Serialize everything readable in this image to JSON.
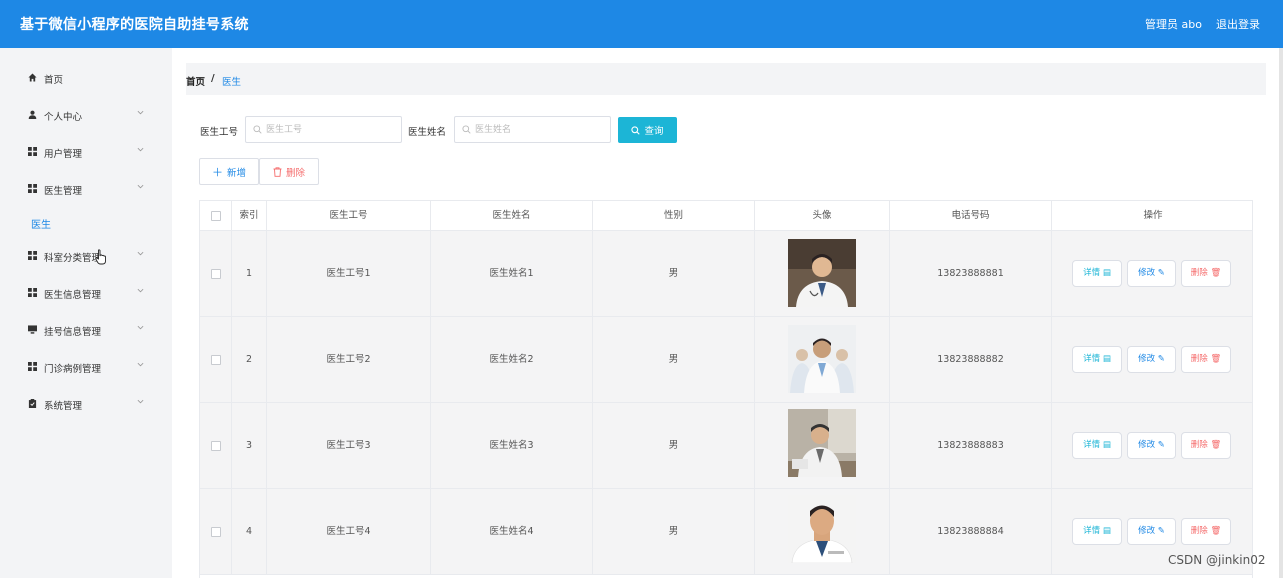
{
  "header": {
    "title": "基于微信小程序的医院自助挂号系统",
    "user": "管理员 abo",
    "logout": "退出登录",
    "color": "#1e88e5"
  },
  "sidebar": {
    "items": [
      {
        "label": "首页",
        "icon": "home-icon",
        "has_chevron": false
      },
      {
        "label": "个人中心",
        "icon": "user-icon",
        "has_chevron": true
      },
      {
        "label": "用户管理",
        "icon": "grid-icon",
        "has_chevron": true
      },
      {
        "label": "医生管理",
        "icon": "grid-icon",
        "has_chevron": true
      },
      {
        "label": "科室分类管理",
        "icon": "grid-icon",
        "has_chevron": true
      },
      {
        "label": "医生信息管理",
        "icon": "grid-icon",
        "has_chevron": true
      },
      {
        "label": "挂号信息管理",
        "icon": "monitor-icon",
        "has_chevron": true
      },
      {
        "label": "门诊病例管理",
        "icon": "grid-icon",
        "has_chevron": true
      },
      {
        "label": "系统管理",
        "icon": "clipboard-icon",
        "has_chevron": true
      }
    ],
    "submenu_active": "医生"
  },
  "breadcrumb": {
    "home": "首页",
    "separator": "/",
    "current": "医生"
  },
  "search": {
    "field1_label": "医生工号",
    "field1_placeholder": "医生工号",
    "field2_label": "医生姓名",
    "field2_placeholder": "医生姓名",
    "query_label": "查询"
  },
  "actions": {
    "add_label": "新增",
    "delete_label": "删除"
  },
  "table": {
    "columns": [
      "索引",
      "医生工号",
      "医生姓名",
      "性别",
      "头像",
      "电话号码",
      "操作"
    ],
    "rows": [
      {
        "index": "1",
        "id": "医生工号1",
        "name": "医生姓名1",
        "gender": "男",
        "phone": "13823888881"
      },
      {
        "index": "2",
        "id": "医生工号2",
        "name": "医生姓名2",
        "gender": "男",
        "phone": "13823888882"
      },
      {
        "index": "3",
        "id": "医生工号3",
        "name": "医生姓名3",
        "gender": "男",
        "phone": "13823888883"
      },
      {
        "index": "4",
        "id": "医生工号4",
        "name": "医生姓名4",
        "gender": "男",
        "phone": "13823888884"
      }
    ],
    "op_labels": {
      "detail": "详情",
      "edit": "修改",
      "remove": "删除"
    }
  },
  "watermark": "CSDN @jinkin02"
}
